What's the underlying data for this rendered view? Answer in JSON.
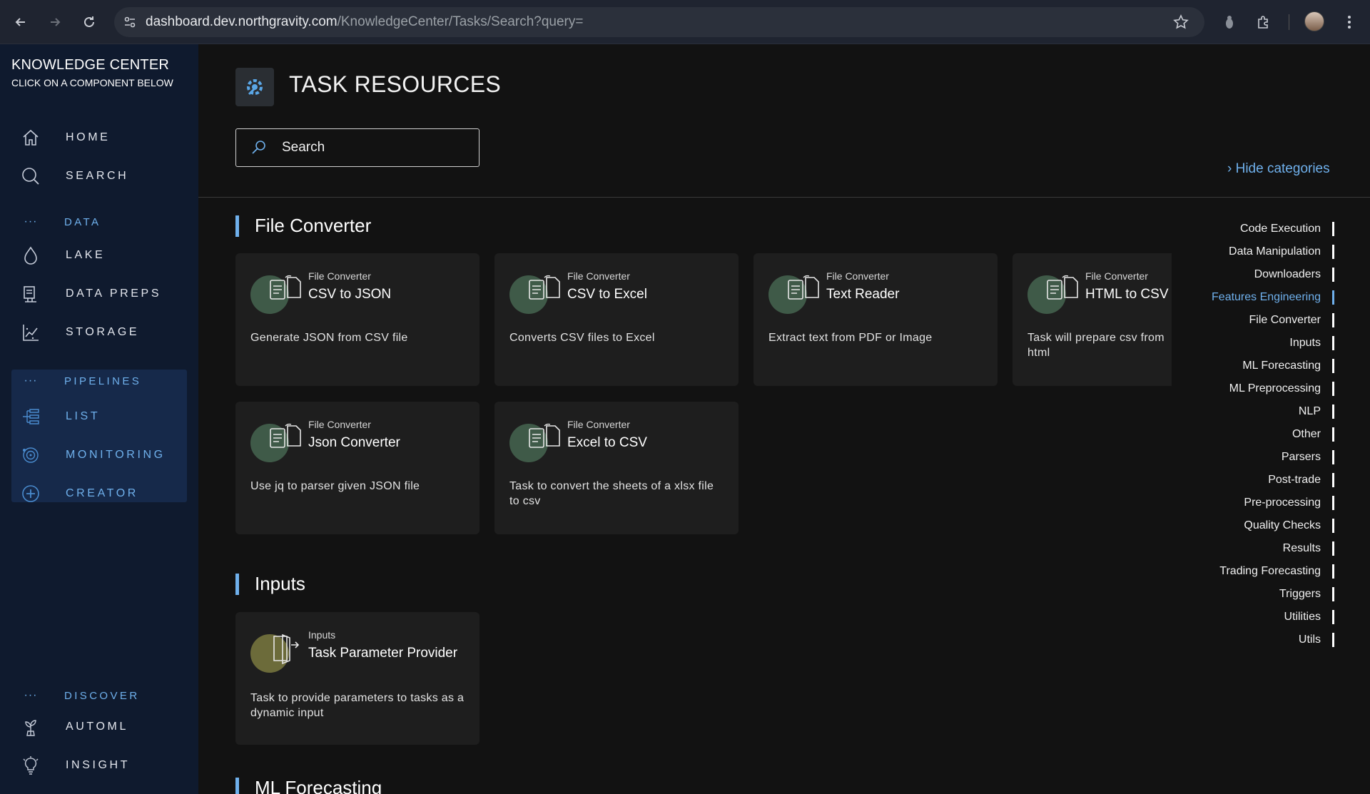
{
  "browser": {
    "url_host": "dashboard.dev.northgravity.com",
    "url_path": "/KnowledgeCenter/Tasks/Search?query="
  },
  "sidebar": {
    "title": "KNOWLEDGE CENTER",
    "subtitle": "CLICK ON A COMPONENT BELOW",
    "top_items": [
      {
        "label": "HOME",
        "icon": "home-icon"
      },
      {
        "label": "SEARCH",
        "icon": "search-icon"
      }
    ],
    "data_section": "DATA",
    "data_items": [
      {
        "label": "LAKE",
        "icon": "droplet-icon"
      },
      {
        "label": "DATA PREPS",
        "icon": "data-preps-icon"
      },
      {
        "label": "STORAGE",
        "icon": "storage-chart-icon"
      }
    ],
    "pipelines_section": "PIPELINES",
    "pipeline_items": [
      {
        "label": "LIST",
        "icon": "list-flow-icon"
      },
      {
        "label": "MONITORING",
        "icon": "monitoring-icon"
      },
      {
        "label": "CREATOR",
        "icon": "plus-circle-icon"
      }
    ],
    "discover_section": "DISCOVER",
    "discover_items": [
      {
        "label": "AUTOML",
        "icon": "plant-icon"
      },
      {
        "label": "INSIGHT",
        "icon": "lightbulb-icon"
      }
    ]
  },
  "main": {
    "title": "TASK RESOURCES",
    "header_icon": "gear-wrench-icon",
    "search_placeholder": "Search",
    "hide_categories": "› Hide categories",
    "sections": [
      {
        "title": "File Converter",
        "cards": [
          {
            "category": "File Converter",
            "name": "CSV to JSON",
            "description": "Generate JSON from CSV file",
            "icon": "file-convert-icon"
          },
          {
            "category": "File Converter",
            "name": "CSV to Excel",
            "description": "Converts CSV files to Excel",
            "icon": "file-convert-icon"
          },
          {
            "category": "File Converter",
            "name": "Text Reader",
            "description": "Extract text from PDF or Image",
            "icon": "file-convert-icon"
          },
          {
            "category": "File Converter",
            "name": "HTML to CSV",
            "description": "Task will prepare csv from html",
            "icon": "file-convert-icon"
          },
          {
            "category": "File Converter",
            "name": "Json Converter",
            "description": "Use jq to parser given JSON file",
            "icon": "file-convert-icon"
          },
          {
            "category": "File Converter",
            "name": "Excel to CSV",
            "description": "Task to convert the sheets of a xlsx file to csv",
            "icon": "file-convert-icon"
          }
        ]
      },
      {
        "title": "Inputs",
        "cards": [
          {
            "category": "Inputs",
            "name": "Task Parameter Provider",
            "description": "Task to provide parameters to tasks as a dynamic input",
            "icon": "input-door-icon"
          }
        ]
      },
      {
        "title": "ML Forecasting",
        "cards": []
      }
    ],
    "categories": [
      "Code Execution",
      "Data Manipulation",
      "Downloaders",
      "Features Engineering",
      "File Converter",
      "Inputs",
      "ML Forecasting",
      "ML Preprocessing",
      "NLP",
      "Other",
      "Parsers",
      "Post-trade",
      "Pre-processing",
      "Quality Checks",
      "Results",
      "Trading Forecasting",
      "Triggers",
      "Utilities",
      "Utils"
    ],
    "active_category": "Features Engineering",
    "colors": {
      "accent": "#6fb0ec",
      "sidebar": "#0f1a2e",
      "card": "#1e1e1e"
    }
  }
}
